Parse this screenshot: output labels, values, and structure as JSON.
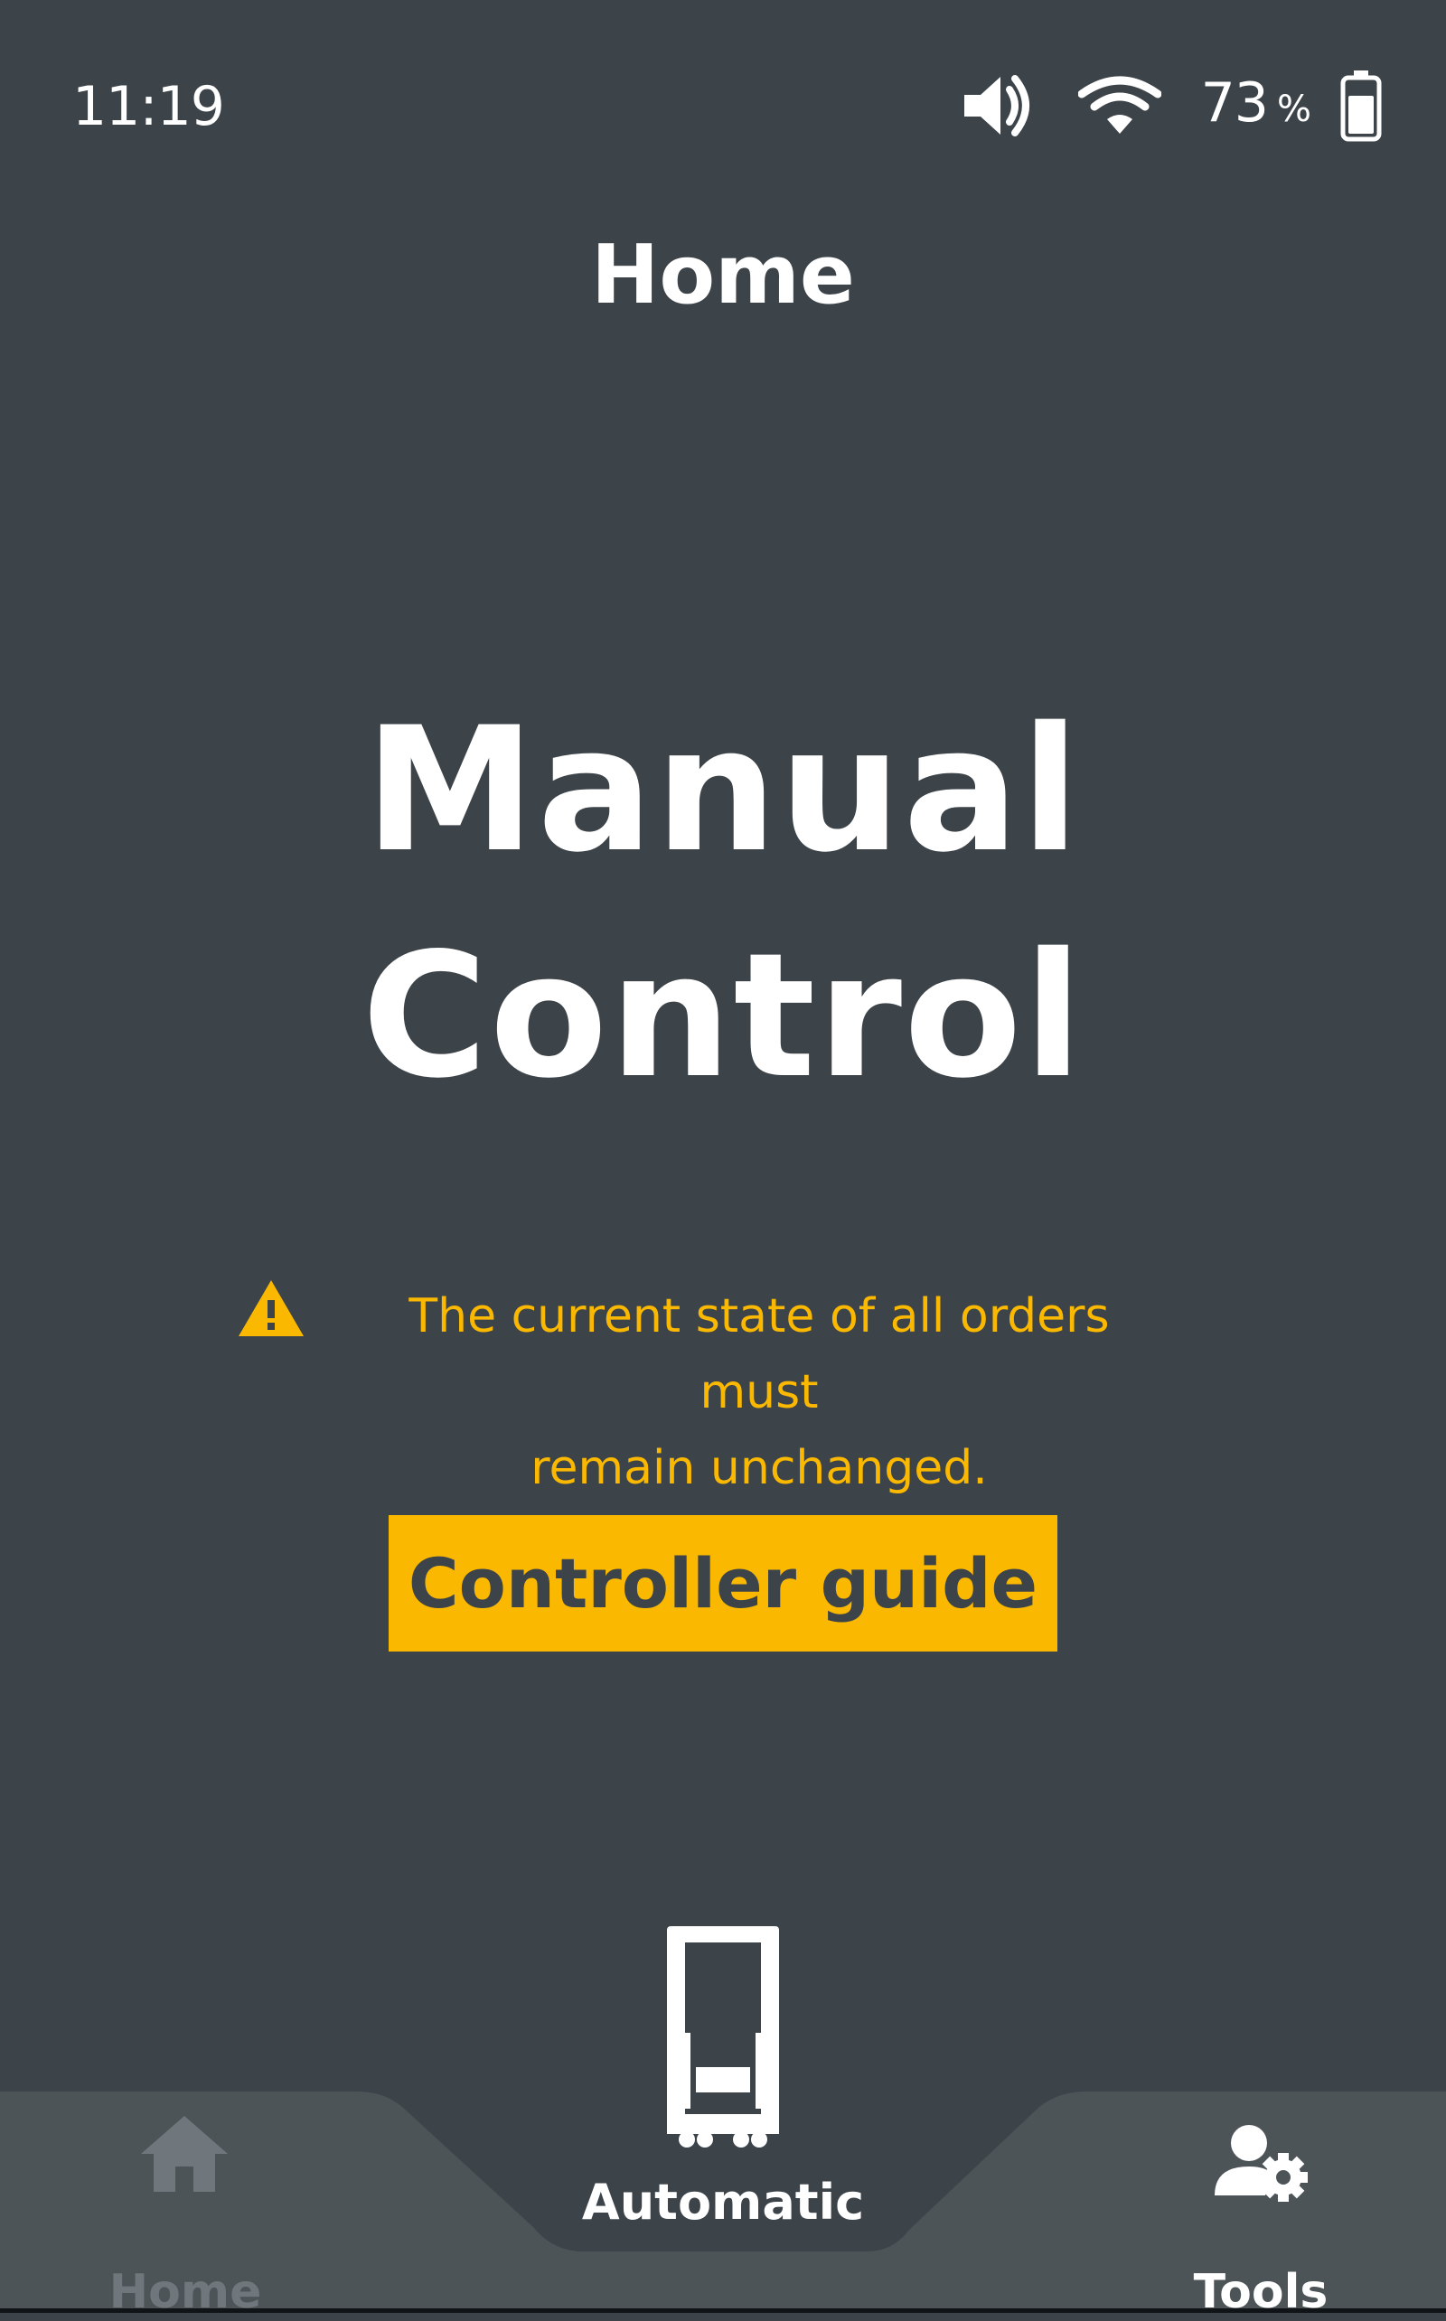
{
  "status_bar": {
    "time": "11:19",
    "battery_percent": "73",
    "battery_unit": "%",
    "icons": [
      "volume-icon",
      "wifi-icon",
      "battery-icon"
    ]
  },
  "header": {
    "title": "Home"
  },
  "main": {
    "mode_line1": "Manual",
    "mode_line2": "Control",
    "warning_line1": "The current state of all orders must",
    "warning_line2": "remain unchanged.",
    "guide_button_label": "Controller guide"
  },
  "bottom_nav": {
    "home_label": "Home",
    "automatic_label": "Automatic",
    "tools_label": "Tools"
  },
  "colors": {
    "background": "#3c4349",
    "nav_background": "#4d5458",
    "accent": "#fbb800",
    "text": "#ffffff",
    "inactive": "#70777c"
  }
}
